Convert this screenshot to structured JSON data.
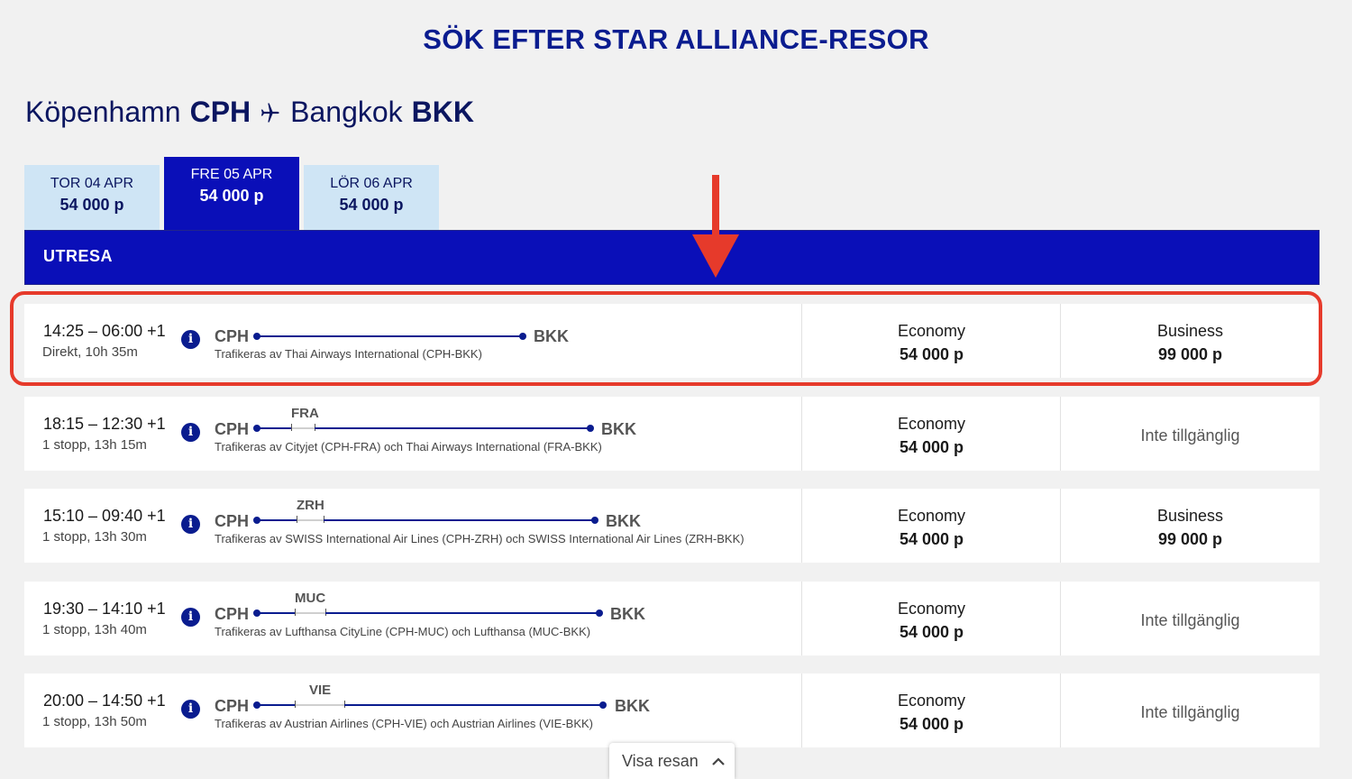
{
  "heading": "SÖK EFTER STAR ALLIANCE-RESOR",
  "route": {
    "origin_city": "Köpenhamn",
    "origin_code": "CPH",
    "dest_city": "Bangkok",
    "dest_code": "BKK",
    "icon": "airplane-icon"
  },
  "date_tabs": [
    {
      "date": "TOR 04 APR",
      "price": "54 000 p",
      "active": false
    },
    {
      "date": "FRE 05 APR",
      "price": "54 000 p",
      "active": true
    },
    {
      "date": "LÖR 06 APR",
      "price": "54 000 p",
      "active": false
    }
  ],
  "section_label": "UTRESA",
  "annotation": {
    "arrow_color": "#e63a2b",
    "highlight_color": "#e63a2b"
  },
  "flights": [
    {
      "time": "14:25 – 06:00 +1",
      "stops": "Direkt, 10h 35m",
      "from": "CPH",
      "to": "BKK",
      "via": "",
      "operated": "Trafikeras av Thai Airways International (CPH-BKK)",
      "economy": {
        "label": "Economy",
        "price": "54 000 p"
      },
      "business": {
        "label": "Business",
        "price": "99 000 p",
        "available": true
      }
    },
    {
      "time": "18:15 – 12:30 +1",
      "stops": "1 stopp, 13h 15m",
      "from": "CPH",
      "to": "BKK",
      "via": "FRA",
      "operated": "Trafikeras av Cityjet (CPH-FRA) och Thai Airways International (FRA-BKK)",
      "economy": {
        "label": "Economy",
        "price": "54 000 p"
      },
      "business": {
        "label": "Inte tillgänglig",
        "price": "",
        "available": false
      }
    },
    {
      "time": "15:10 – 09:40 +1",
      "stops": "1 stopp, 13h 30m",
      "from": "CPH",
      "to": "BKK",
      "via": "ZRH",
      "operated": "Trafikeras av SWISS International Air Lines (CPH-ZRH) och SWISS International Air Lines (ZRH-BKK)",
      "economy": {
        "label": "Economy",
        "price": "54 000 p"
      },
      "business": {
        "label": "Business",
        "price": "99 000 p",
        "available": true
      }
    },
    {
      "time": "19:30 – 14:10 +1",
      "stops": "1 stopp, 13h 40m",
      "from": "CPH",
      "to": "BKK",
      "via": "MUC",
      "operated": "Trafikeras av Lufthansa CityLine (CPH-MUC) och Lufthansa (MUC-BKK)",
      "economy": {
        "label": "Economy",
        "price": "54 000 p"
      },
      "business": {
        "label": "Inte tillgänglig",
        "price": "",
        "available": false
      }
    },
    {
      "time": "20:00 – 14:50 +1",
      "stops": "1 stopp, 13h 50m",
      "from": "CPH",
      "to": "BKK",
      "via": "VIE",
      "operated": "Trafikeras av Austrian Airlines (CPH-VIE) och Austrian Airlines (VIE-BKK)",
      "economy": {
        "label": "Economy",
        "price": "54 000 p"
      },
      "business": {
        "label": "Inte tillgänglig",
        "price": "",
        "available": false
      }
    }
  ],
  "show_trip": {
    "label": "Visa resan",
    "icon": "chevron-up-icon"
  }
}
